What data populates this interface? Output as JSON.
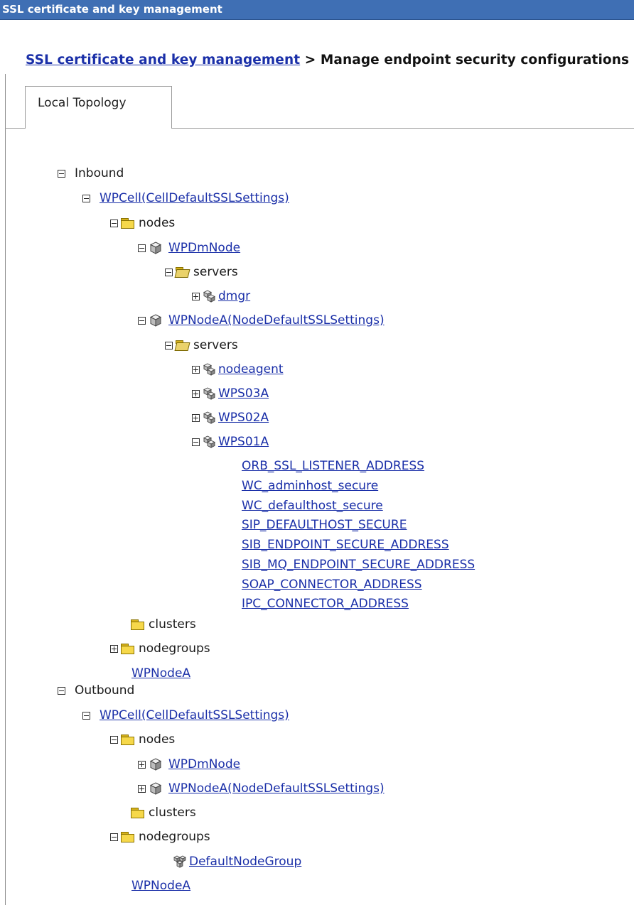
{
  "window": {
    "title": "SSL certificate and key management"
  },
  "breadcrumb": {
    "link": "SSL certificate and key management",
    "separator": " > ",
    "current": "Manage endpoint security configurations"
  },
  "tabs": [
    {
      "label": "Local Topology"
    }
  ],
  "tree": {
    "inbound": {
      "label": "Inbound",
      "cell": "WPCell(CellDefaultSSLSettings)",
      "nodes": "nodes",
      "dmnode": "WPDmNode",
      "servers1": "servers",
      "dmgr": "dmgr",
      "nodea": "WPNodeA(NodeDefaultSSLSettings)",
      "servers2": "servers",
      "nodeagent": "nodeagent",
      "wps03a": "WPS03A",
      "wps02a": "WPS02A",
      "wps01a": "WPS01A",
      "endpoints": [
        "ORB_SSL_LISTENER_ADDRESS",
        "WC_adminhost_secure",
        "WC_defaulthost_secure",
        "SIP_DEFAULTHOST_SECURE",
        "SIB_ENDPOINT_SECURE_ADDRESS",
        "SIB_MQ_ENDPOINT_SECURE_ADDRESS",
        "SOAP_CONNECTOR_ADDRESS",
        "IPC_CONNECTOR_ADDRESS"
      ],
      "clusters": "clusters",
      "nodegroups": "nodegroups",
      "nodea_short": "WPNodeA"
    },
    "outbound": {
      "label": "Outbound",
      "cell": "WPCell(CellDefaultSSLSettings)",
      "nodes": "nodes",
      "dmnode": "WPDmNode",
      "nodea": "WPNodeA(NodeDefaultSSLSettings)",
      "clusters": "clusters",
      "nodegroups": "nodegroups",
      "defaultgroup": "DefaultNodeGroup",
      "nodea_short": "WPNodeA"
    }
  },
  "colors": {
    "titlebar": "#3f6fb4",
    "link": "#1a2fa8",
    "folder": "#f6d84a"
  }
}
